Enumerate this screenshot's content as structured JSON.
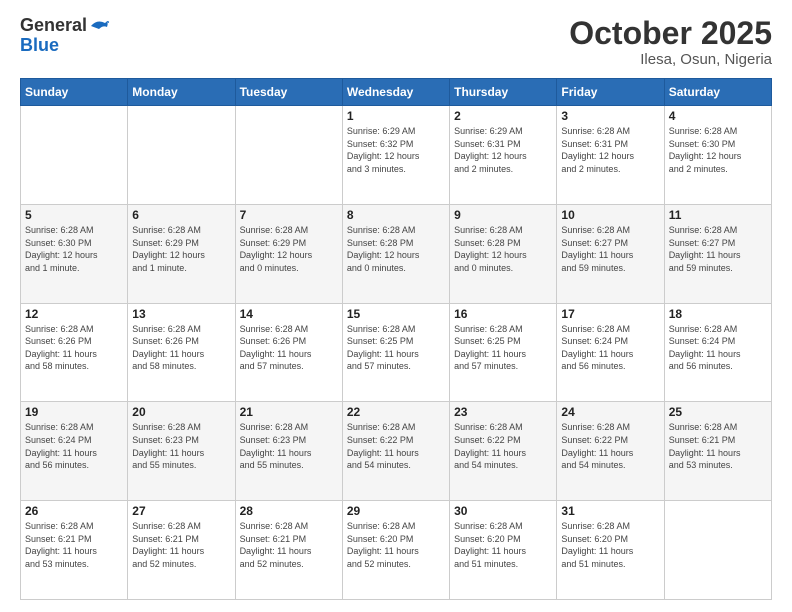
{
  "logo": {
    "line1": "General",
    "line2": "Blue"
  },
  "title": "October 2025",
  "location": "Ilesa, Osun, Nigeria",
  "days_of_week": [
    "Sunday",
    "Monday",
    "Tuesday",
    "Wednesday",
    "Thursday",
    "Friday",
    "Saturday"
  ],
  "weeks": [
    [
      {
        "day": "",
        "info": ""
      },
      {
        "day": "",
        "info": ""
      },
      {
        "day": "",
        "info": ""
      },
      {
        "day": "1",
        "info": "Sunrise: 6:29 AM\nSunset: 6:32 PM\nDaylight: 12 hours\nand 3 minutes."
      },
      {
        "day": "2",
        "info": "Sunrise: 6:29 AM\nSunset: 6:31 PM\nDaylight: 12 hours\nand 2 minutes."
      },
      {
        "day": "3",
        "info": "Sunrise: 6:28 AM\nSunset: 6:31 PM\nDaylight: 12 hours\nand 2 minutes."
      },
      {
        "day": "4",
        "info": "Sunrise: 6:28 AM\nSunset: 6:30 PM\nDaylight: 12 hours\nand 2 minutes."
      }
    ],
    [
      {
        "day": "5",
        "info": "Sunrise: 6:28 AM\nSunset: 6:30 PM\nDaylight: 12 hours\nand 1 minute."
      },
      {
        "day": "6",
        "info": "Sunrise: 6:28 AM\nSunset: 6:29 PM\nDaylight: 12 hours\nand 1 minute."
      },
      {
        "day": "7",
        "info": "Sunrise: 6:28 AM\nSunset: 6:29 PM\nDaylight: 12 hours\nand 0 minutes."
      },
      {
        "day": "8",
        "info": "Sunrise: 6:28 AM\nSunset: 6:28 PM\nDaylight: 12 hours\nand 0 minutes."
      },
      {
        "day": "9",
        "info": "Sunrise: 6:28 AM\nSunset: 6:28 PM\nDaylight: 12 hours\nand 0 minutes."
      },
      {
        "day": "10",
        "info": "Sunrise: 6:28 AM\nSunset: 6:27 PM\nDaylight: 11 hours\nand 59 minutes."
      },
      {
        "day": "11",
        "info": "Sunrise: 6:28 AM\nSunset: 6:27 PM\nDaylight: 11 hours\nand 59 minutes."
      }
    ],
    [
      {
        "day": "12",
        "info": "Sunrise: 6:28 AM\nSunset: 6:26 PM\nDaylight: 11 hours\nand 58 minutes."
      },
      {
        "day": "13",
        "info": "Sunrise: 6:28 AM\nSunset: 6:26 PM\nDaylight: 11 hours\nand 58 minutes."
      },
      {
        "day": "14",
        "info": "Sunrise: 6:28 AM\nSunset: 6:26 PM\nDaylight: 11 hours\nand 57 minutes."
      },
      {
        "day": "15",
        "info": "Sunrise: 6:28 AM\nSunset: 6:25 PM\nDaylight: 11 hours\nand 57 minutes."
      },
      {
        "day": "16",
        "info": "Sunrise: 6:28 AM\nSunset: 6:25 PM\nDaylight: 11 hours\nand 57 minutes."
      },
      {
        "day": "17",
        "info": "Sunrise: 6:28 AM\nSunset: 6:24 PM\nDaylight: 11 hours\nand 56 minutes."
      },
      {
        "day": "18",
        "info": "Sunrise: 6:28 AM\nSunset: 6:24 PM\nDaylight: 11 hours\nand 56 minutes."
      }
    ],
    [
      {
        "day": "19",
        "info": "Sunrise: 6:28 AM\nSunset: 6:24 PM\nDaylight: 11 hours\nand 56 minutes."
      },
      {
        "day": "20",
        "info": "Sunrise: 6:28 AM\nSunset: 6:23 PM\nDaylight: 11 hours\nand 55 minutes."
      },
      {
        "day": "21",
        "info": "Sunrise: 6:28 AM\nSunset: 6:23 PM\nDaylight: 11 hours\nand 55 minutes."
      },
      {
        "day": "22",
        "info": "Sunrise: 6:28 AM\nSunset: 6:22 PM\nDaylight: 11 hours\nand 54 minutes."
      },
      {
        "day": "23",
        "info": "Sunrise: 6:28 AM\nSunset: 6:22 PM\nDaylight: 11 hours\nand 54 minutes."
      },
      {
        "day": "24",
        "info": "Sunrise: 6:28 AM\nSunset: 6:22 PM\nDaylight: 11 hours\nand 54 minutes."
      },
      {
        "day": "25",
        "info": "Sunrise: 6:28 AM\nSunset: 6:21 PM\nDaylight: 11 hours\nand 53 minutes."
      }
    ],
    [
      {
        "day": "26",
        "info": "Sunrise: 6:28 AM\nSunset: 6:21 PM\nDaylight: 11 hours\nand 53 minutes."
      },
      {
        "day": "27",
        "info": "Sunrise: 6:28 AM\nSunset: 6:21 PM\nDaylight: 11 hours\nand 52 minutes."
      },
      {
        "day": "28",
        "info": "Sunrise: 6:28 AM\nSunset: 6:21 PM\nDaylight: 11 hours\nand 52 minutes."
      },
      {
        "day": "29",
        "info": "Sunrise: 6:28 AM\nSunset: 6:20 PM\nDaylight: 11 hours\nand 52 minutes."
      },
      {
        "day": "30",
        "info": "Sunrise: 6:28 AM\nSunset: 6:20 PM\nDaylight: 11 hours\nand 51 minutes."
      },
      {
        "day": "31",
        "info": "Sunrise: 6:28 AM\nSunset: 6:20 PM\nDaylight: 11 hours\nand 51 minutes."
      },
      {
        "day": "",
        "info": ""
      }
    ]
  ]
}
